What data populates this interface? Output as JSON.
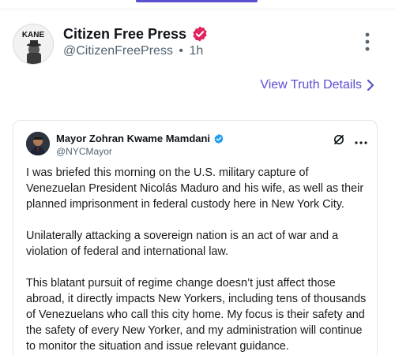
{
  "post": {
    "author_name": "Citizen Free Press",
    "author_handle": "@CitizenFreePress",
    "separator": "•",
    "time_ago": "1h",
    "avatar_text": "KANE",
    "verified_color": "#e0245e"
  },
  "links": {
    "view_truth_details": "View Truth Details"
  },
  "embed": {
    "author_name": "Mayor Zohran Kwame Mamdani",
    "author_handle": "@NYCMayor",
    "verified_color": "#1d9bf0",
    "paragraphs": [
      "I was briefed this morning on the U.S. military capture of Venezuelan President Nicolás Maduro and his wife, as well as their planned imprisonment in federal custody here in New York City.",
      "Unilaterally attacking a sovereign nation is an act of war and a violation of federal and international law.",
      "This blatant pursuit of regime change doesn’t just affect those abroad, it directly impacts New Yorkers, including tens of thousands of Venezuelans who call this city home. My focus is their safety and the safety of every New Yorker, and my administration will continue to monitor the situation and issue relevant guidance."
    ]
  },
  "colors": {
    "accent": "#5a4fcf",
    "text_primary": "#0f1419",
    "text_secondary": "#536471"
  },
  "icons": {
    "more": "more-vert-icon",
    "chevron": "chevron-right-icon",
    "x_logo": "x-logo-icon",
    "embed_more": "more-horiz-icon"
  }
}
